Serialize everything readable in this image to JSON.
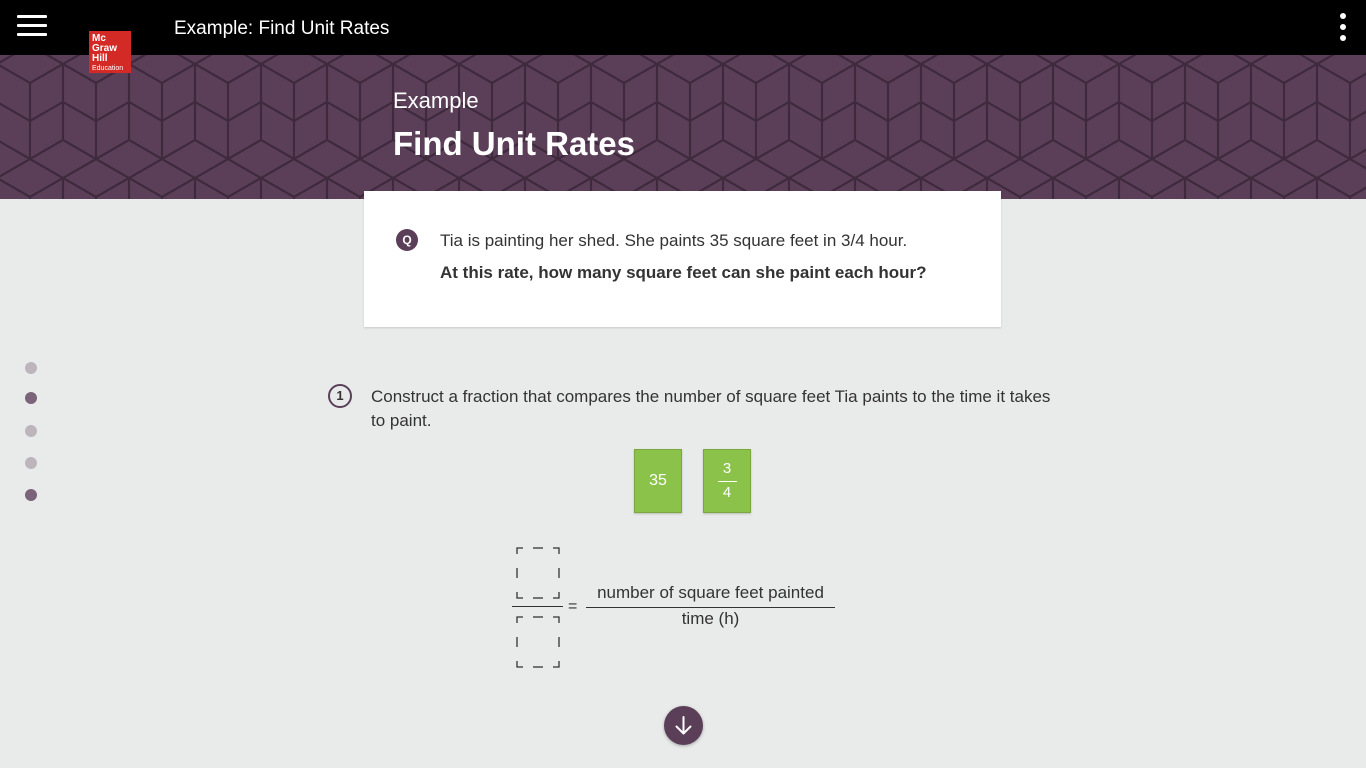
{
  "header": {
    "title": "Example: Find Unit Rates"
  },
  "logo": {
    "lines": [
      "Mc",
      "Graw",
      "Hill",
      "Education"
    ],
    "color": "#d42a25"
  },
  "banner": {
    "eyebrow": "Example",
    "title": "Find Unit Rates",
    "color": "#5b3f58"
  },
  "question": {
    "icon_letter": "Q",
    "text": "Tia is painting her shed. She paints 35 square feet in 3/4 hour.",
    "prompt": "At this rate, how many square feet can she paint each hour?"
  },
  "progress": {
    "steps": [
      {
        "state": "todo"
      },
      {
        "state": "done"
      },
      {
        "state": "todo"
      },
      {
        "state": "todo"
      },
      {
        "state": "done"
      }
    ]
  },
  "step": {
    "number": "1",
    "text": "Construct a fraction that compares the number of square feet Tia paints to the time it takes to paint.",
    "tiles": {
      "whole": "35",
      "frac_num": "3",
      "frac_den": "4",
      "color": "#8bc34a"
    },
    "equation": {
      "equals": "=",
      "numerator": "number of square feet painted",
      "denominator": "time (h)"
    }
  },
  "icons": {
    "menu": "hamburger-icon",
    "more": "kebab-icon",
    "next": "arrow-down-icon"
  }
}
